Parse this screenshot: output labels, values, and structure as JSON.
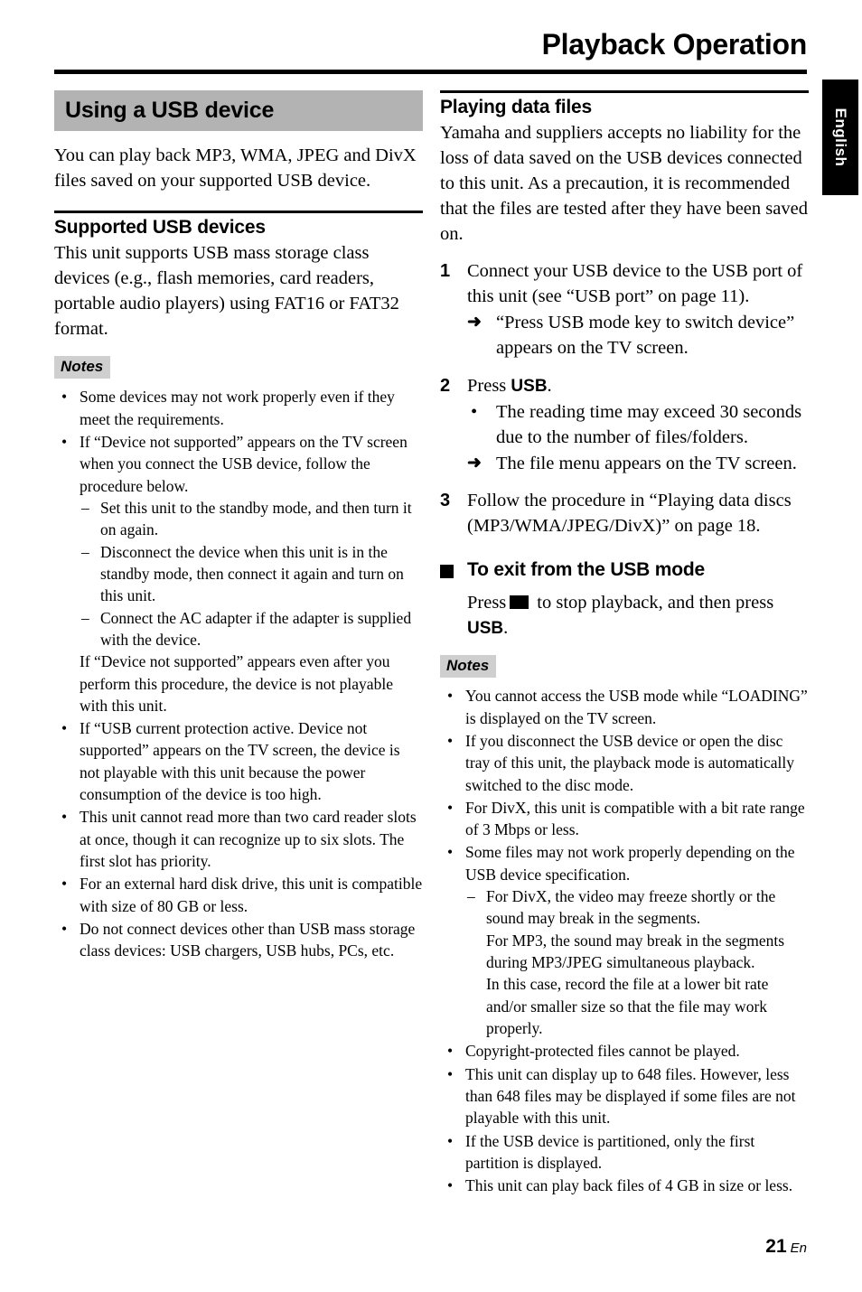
{
  "header": {
    "title": "Playback Operation",
    "side_tab_label": "English"
  },
  "footer": {
    "page_number": "21",
    "language_code": "En"
  },
  "left_column": {
    "section_heading": "Using a USB device",
    "intro": "You can play back MP3, WMA, JPEG and DivX files saved on your supported USB device.",
    "sub_heading": "Supported USB devices",
    "sub_body": "This unit supports USB mass storage class devices (e.g., flash memories, card readers, portable audio players) using FAT16 or FAT32 format.",
    "notes_label": "Notes",
    "notes": {
      "item1": "Some devices may not work properly even if they meet the requirements.",
      "item2_intro": "If “Device not supported” appears on the TV screen when you connect the USB device, follow the procedure below.",
      "item2_sub1": "Set this unit to the standby mode, and then turn it on again.",
      "item2_sub2": "Disconnect the device when this unit is in the standby mode, then connect it again and turn on this unit.",
      "item2_sub3": "Connect the AC adapter if the adapter is supplied with the device.",
      "item2_outro": "If “Device not supported” appears even after you perform this procedure, the device is not playable with this unit.",
      "item3": "If “USB current protection active. Device not supported” appears on the TV screen, the device is not playable with this unit because the power consumption of the device is too high.",
      "item4": "This unit cannot read more than two card reader slots at once, though it can recognize up to six slots. The first slot has priority.",
      "item5": "For an external hard disk drive, this unit is compatible with size of 80 GB or less.",
      "item6": "Do not connect devices other than USB mass storage class devices: USB chargers, USB hubs, PCs, etc."
    }
  },
  "right_column": {
    "heading": "Playing data files",
    "intro": "Yamaha and suppliers accepts no liability for the loss of data saved on the USB devices connected to this unit. As a precaution, it is recommended that the files are tested after they have been saved on.",
    "steps": [
      {
        "number": "1",
        "text": "Connect your USB device to the USB port of this unit (see “USB port” on page 11).",
        "arrow_note": "“Press USB mode key to switch device” appears on the TV screen."
      },
      {
        "number": "2",
        "text_prefix": "Press ",
        "text_key": "USB",
        "text_suffix": ".",
        "bullet_note": "The reading time may exceed 30 seconds due to the number of files/folders.",
        "arrow_note": "The file menu appears on the TV screen."
      },
      {
        "number": "3",
        "text": "Follow the procedure in “Playing data discs (MP3/WMA/JPEG/DivX)” on page 18."
      }
    ],
    "exit_heading": "To exit from the USB mode",
    "exit_prefix": "Press",
    "exit_middle": "to stop playback, and then press",
    "exit_key": "USB",
    "exit_suffix": ".",
    "notes_label": "Notes",
    "notes": {
      "item1": "You cannot access the USB mode while “LOADING” is displayed on the TV screen.",
      "item2": "If you disconnect the USB device or open the disc tray of this unit, the playback mode is automatically switched to the disc mode.",
      "item3": "For DivX, this unit is compatible with a bit rate range of 3 Mbps or less.",
      "item4": "Some files may not work properly depending on the USB device specification.",
      "item4_sub_line1": "For DivX, the video may freeze shortly or the sound may break in the segments.",
      "item4_sub_line2": "For MP3, the sound may break in the segments during MP3/JPEG simultaneous playback.",
      "item4_sub_line3": "In this case, record the file at a lower bit rate and/or smaller size so that the file may work properly.",
      "item5": "Copyright-protected files cannot be played.",
      "item6": "This unit can display up to 648 files. However, less than 648 files may be displayed if some files are not playable with this unit.",
      "item7": "If the USB device is partitioned, only the first partition is displayed.",
      "item8": "This unit can play back files of 4 GB in size or less."
    }
  },
  "glyphs": {
    "bullet": "•",
    "dash": "–",
    "arrow": "➜"
  },
  "colors": {
    "heading_band": "#b3b3b3",
    "notes_band": "#cfcfcf",
    "rule": "#000000",
    "tab_background": "#000000",
    "tab_text": "#ffffff"
  }
}
